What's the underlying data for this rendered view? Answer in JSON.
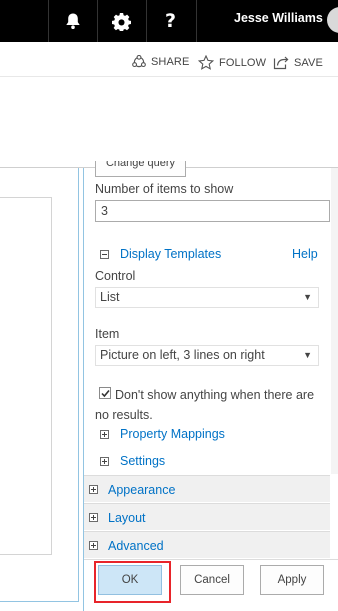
{
  "suite_bar": {
    "user_name": "Jesse Williams",
    "icons": [
      "bell-icon",
      "gear-icon",
      "help-icon"
    ],
    "help_glyph": "?"
  },
  "action_bar": {
    "share_label": "SHARE",
    "follow_label": "FOLLOW",
    "save_label": "SAVE"
  },
  "tool_pane": {
    "cutoff_button_label": "Change query",
    "items_count_label": "Number of items to show",
    "items_count_value": "3",
    "display_templates": {
      "title": "Display Templates",
      "help_link": "Help",
      "control_label": "Control",
      "control_value": "List",
      "item_label": "Item",
      "item_value": "Picture on left, 3 lines on right"
    },
    "no_results_checkbox": {
      "label": "Don't show anything when there are no results.",
      "checked": true
    },
    "sections": {
      "property_mappings": "Property Mappings",
      "settings": "Settings"
    },
    "categories": {
      "appearance": "Appearance",
      "layout": "Layout",
      "advanced": "Advanced"
    },
    "buttons": {
      "ok": "OK",
      "cancel": "Cancel",
      "apply": "Apply"
    }
  },
  "colors": {
    "suite_bar_bg": "#000000",
    "link_blue": "#0072c6",
    "canvas_border": "#92c4e2",
    "ok_button_bg": "#cde6f7",
    "highlight_red": "#e8242a"
  }
}
